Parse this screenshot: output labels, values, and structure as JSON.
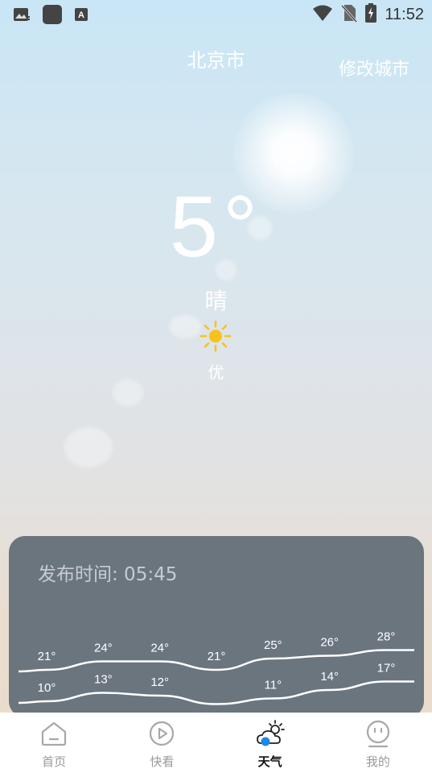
{
  "status_bar": {
    "time": "11:52",
    "left_icons": [
      "gallery-notification-icon",
      "app-notification-icon",
      "font-notification-icon"
    ],
    "right_icons": [
      "wifi-icon",
      "no-sim-icon",
      "battery-charging-icon"
    ]
  },
  "header": {
    "city": "北京市",
    "edit_city_label": "修改城市"
  },
  "current": {
    "temperature": "5°",
    "condition": "晴",
    "condition_icon": "sun-icon",
    "air_quality": "优"
  },
  "forecast": {
    "publish_label": "发布时间: 05:45",
    "highs": [
      "21°",
      "24°",
      "24°",
      "21°",
      "25°",
      "26°",
      "28°"
    ],
    "lows": [
      "10°",
      "13°",
      "12°",
      "",
      "11°",
      "14°",
      "17°"
    ],
    "high_values": [
      21,
      24,
      24,
      21,
      25,
      26,
      28
    ],
    "low_values": [
      10,
      13,
      12,
      9,
      11,
      14,
      17
    ]
  },
  "nav": {
    "items": [
      {
        "label": "首页",
        "icon": "home-icon"
      },
      {
        "label": "快看",
        "icon": "play-icon"
      },
      {
        "label": "天气",
        "icon": "weather-icon"
      },
      {
        "label": "我的",
        "icon": "profile-icon"
      }
    ],
    "active_index": 2
  },
  "colors": {
    "card_bg": "#6b757e",
    "sun_yellow": "#f7c21a",
    "nav_active_blue": "#1e88e5"
  }
}
